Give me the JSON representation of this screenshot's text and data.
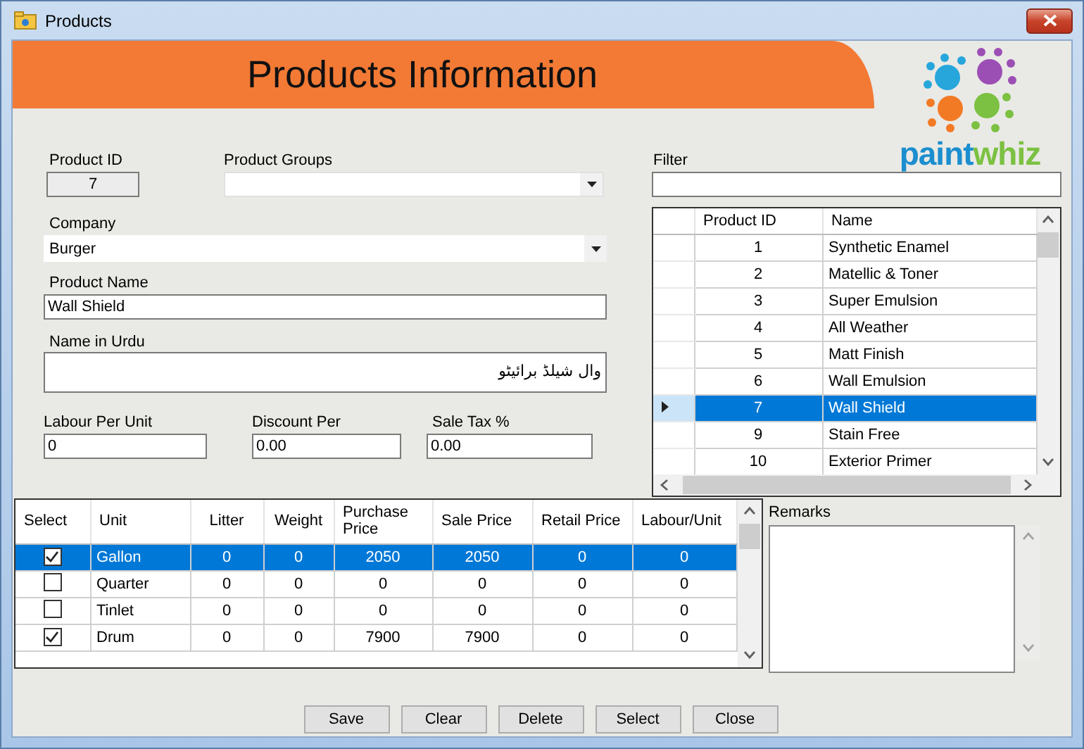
{
  "window": {
    "title": "Products"
  },
  "header": {
    "title": "Products Information",
    "logo": [
      {
        "text": "paint",
        "color": "#1b8ecf"
      },
      {
        "text": "whiz",
        "color": "#7cc142"
      }
    ]
  },
  "form": {
    "product_id": {
      "label": "Product ID",
      "value": "7"
    },
    "product_groups": {
      "label": "Product Groups"
    },
    "company": {
      "label": "Company",
      "value": "Burger"
    },
    "product_name": {
      "label": "Product Name",
      "value": "Wall Shield"
    },
    "name_in_urdu": {
      "label": "Name in Urdu",
      "value": "وال شیلڈ برائیٹو"
    },
    "numbers": [
      {
        "label": "Labour Per Unit",
        "value": "0"
      },
      {
        "label": "Discount Per",
        "value": "0.00"
      },
      {
        "label": "Sale Tax %",
        "value": "0.00"
      }
    ]
  },
  "filter": {
    "label": "Filter"
  },
  "products_grid": {
    "columns": [
      "Product ID",
      "Name"
    ],
    "rows": [
      {
        "id": "1",
        "name": "Synthetic Enamel",
        "selected": false
      },
      {
        "id": "2",
        "name": "Matellic & Toner",
        "selected": false
      },
      {
        "id": "3",
        "name": "Super Emulsion",
        "selected": false
      },
      {
        "id": "4",
        "name": "All Weather",
        "selected": false
      },
      {
        "id": "5",
        "name": "Matt Finish",
        "selected": false
      },
      {
        "id": "6",
        "name": "Wall Emulsion",
        "selected": false
      },
      {
        "id": "7",
        "name": "Wall Shield",
        "selected": true
      },
      {
        "id": "9",
        "name": "Stain Free",
        "selected": false
      },
      {
        "id": "10",
        "name": "Exterior Primer",
        "selected": false
      }
    ]
  },
  "units_grid": {
    "checkbox_column": "Select",
    "columns": [
      "Unit",
      "Litter",
      "Weight",
      "Purchase Price",
      "Sale Price",
      "Retail Price",
      "Labour/Unit"
    ],
    "rows": [
      {
        "checked": true,
        "selected": true,
        "cells": [
          "Gallon",
          "0",
          "0",
          "2050",
          "2050",
          "0",
          "0"
        ]
      },
      {
        "checked": false,
        "selected": false,
        "cells": [
          "Quarter",
          "0",
          "0",
          "0",
          "0",
          "0",
          "0"
        ]
      },
      {
        "checked": false,
        "selected": false,
        "cells": [
          "Tinlet",
          "0",
          "0",
          "0",
          "0",
          "0",
          "0"
        ]
      },
      {
        "checked": true,
        "selected": false,
        "cells": [
          "Drum",
          "0",
          "0",
          "7900",
          "7900",
          "0",
          "0"
        ]
      }
    ]
  },
  "remarks": {
    "label": "Remarks"
  },
  "buttons": [
    "Save",
    "Clear",
    "Delete",
    "Select",
    "Close"
  ]
}
